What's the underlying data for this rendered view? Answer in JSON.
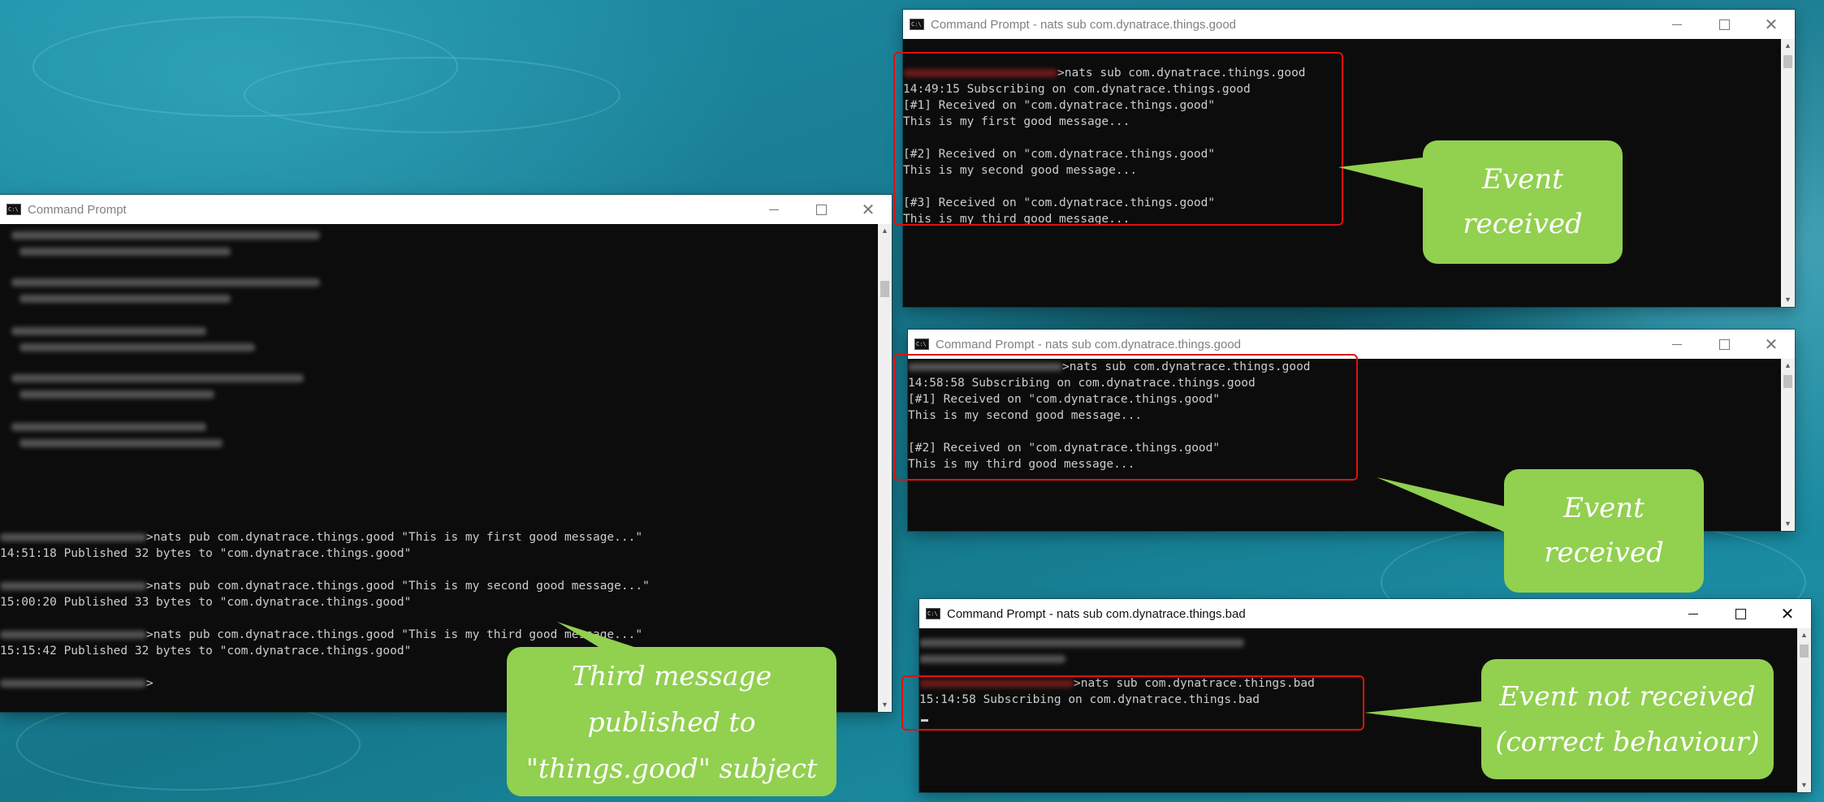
{
  "win_left": {
    "title": "Command Prompt",
    "lines": [
      {
        "prefix_blur": true,
        "text": ">nats pub com.dynatrace.things.good \"This is my first good message...\""
      },
      {
        "prefix_blur": false,
        "text": "14:51:18 Published 32 bytes to \"com.dynatrace.things.good\""
      },
      {
        "prefix_blur": true,
        "text": ">nats pub com.dynatrace.things.good \"This is my second good message...\""
      },
      {
        "prefix_blur": false,
        "text": "15:00:20 Published 33 bytes to \"com.dynatrace.things.good\""
      },
      {
        "prefix_blur": true,
        "text": ">nats pub com.dynatrace.things.good \"This is my third good message...\""
      },
      {
        "prefix_blur": false,
        "text": "15:15:42 Published 32 bytes to \"com.dynatrace.things.good\""
      },
      {
        "prefix_blur": true,
        "text": ">"
      }
    ]
  },
  "win_top": {
    "title": "Command Prompt - nats  sub com.dynatrace.things.good",
    "lines": [
      ">nats sub com.dynatrace.things.good",
      "14:49:15 Subscribing on com.dynatrace.things.good",
      "[#1] Received on \"com.dynatrace.things.good\"",
      "This is my first good message...",
      "",
      "[#2] Received on \"com.dynatrace.things.good\"",
      "This is my second good message...",
      "",
      "[#3] Received on \"com.dynatrace.things.good\"",
      "This is my third good message..."
    ]
  },
  "win_mid": {
    "title": "Command Prompt - nats  sub com.dynatrace.things.good",
    "lines": [
      ">nats sub com.dynatrace.things.good",
      "14:58:58 Subscribing on com.dynatrace.things.good",
      "[#1] Received on \"com.dynatrace.things.good\"",
      "This is my second good message...",
      "",
      "[#2] Received on \"com.dynatrace.things.good\"",
      "This is my third good message..."
    ]
  },
  "win_bot": {
    "title": "Command Prompt - nats  sub com.dynatrace.things.bad",
    "lines": [
      ">nats sub com.dynatrace.things.bad",
      "15:14:58 Subscribing on com.dynatrace.things.bad"
    ]
  },
  "callouts": {
    "top": [
      "Event",
      "received"
    ],
    "mid": [
      "Event",
      "received"
    ],
    "bot": [
      "Event not received",
      "(correct behaviour)"
    ],
    "left": [
      "Third message",
      "published to",
      "\"things.good\" subject"
    ]
  },
  "colors": {
    "callout_green": "#92d050",
    "highlight_red": "#e01010",
    "console_bg": "#0c0c0c",
    "console_text": "#cccccc"
  }
}
